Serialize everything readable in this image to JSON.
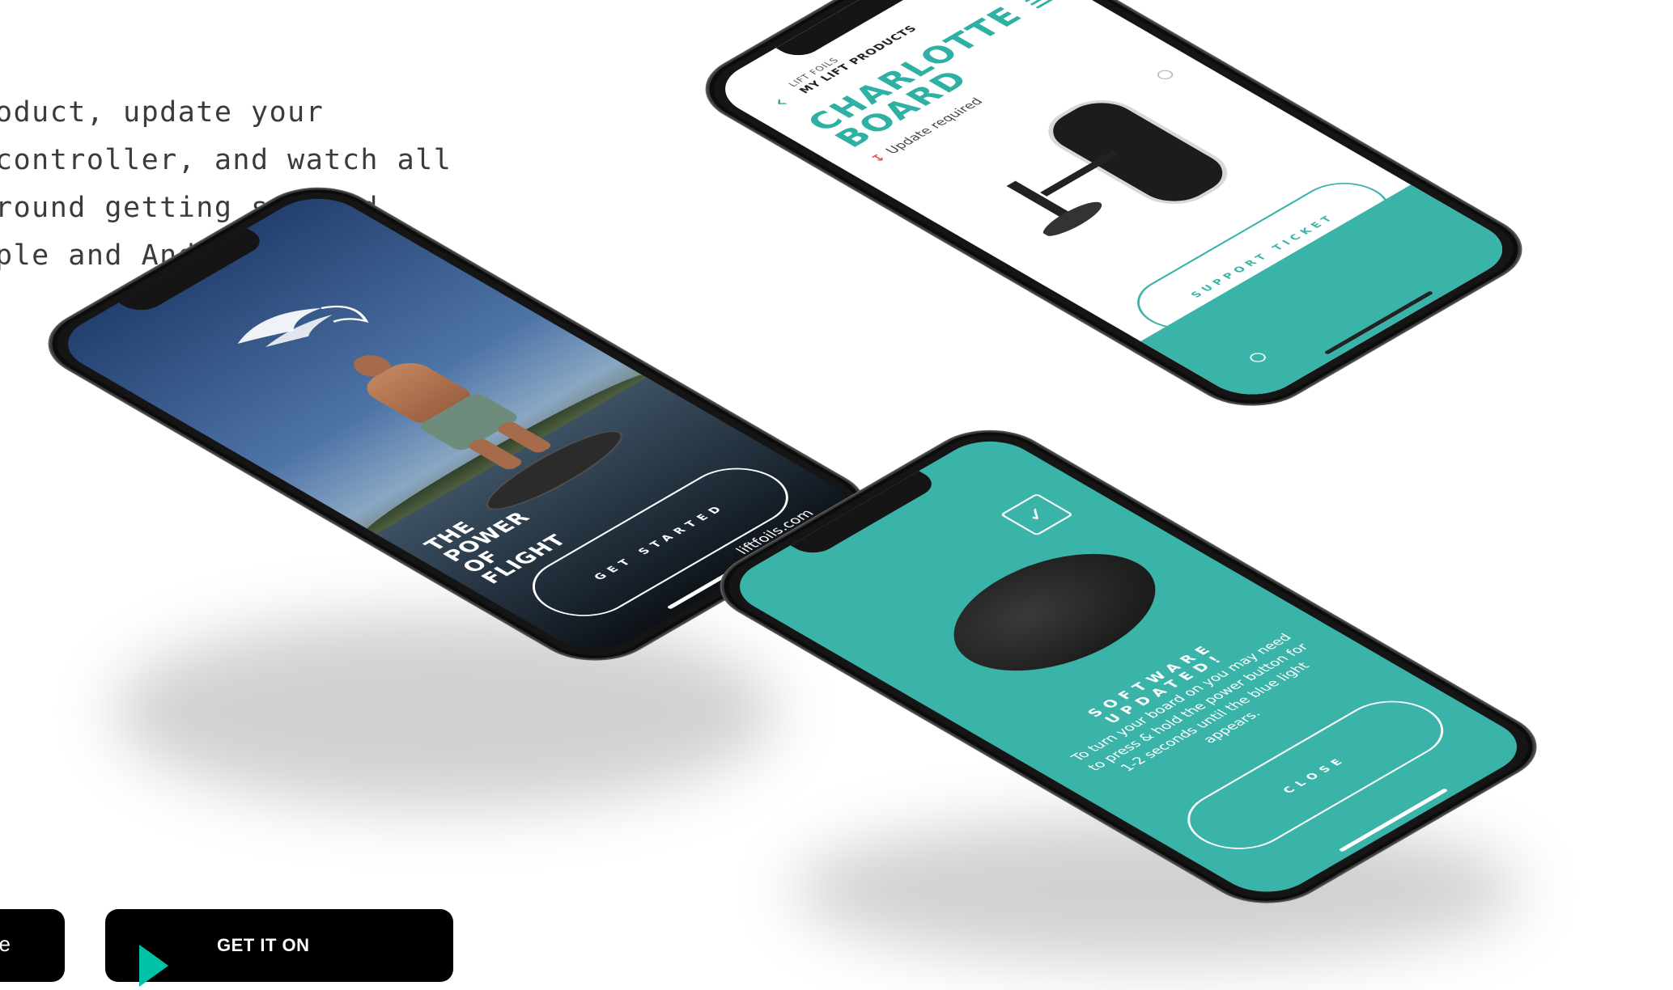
{
  "intro": {
    "lines": [
      "oduct, update your",
      " controller, and watch all",
      "round getting started",
      "ple and Android."
    ]
  },
  "phone_left": {
    "headline": [
      "THE",
      "POWER",
      "OF",
      "FLIGHT"
    ],
    "button_label": "GET STARTED",
    "site": "liftfoils.com"
  },
  "phone_top": {
    "breadcrumb_small": "LIFT FOILS",
    "breadcrumb": "MY LIFT PRODUCTS",
    "title": [
      "CHARLOTTE",
      "BOARD"
    ],
    "update_status": "Update required",
    "button_label": "SUPPORT TICKET"
  },
  "phone_bottom": {
    "heading": "SOFTWARE UPDATED!",
    "message": "To turn your board on you may need to press & hold the power button for 1-2 seconds until the blue light appears.",
    "button_label": "CLOSE"
  },
  "badges": {
    "apple_fragment": "he",
    "google_label": "GET IT ON"
  },
  "colors": {
    "accent_teal": "#3ab3a9",
    "alert_red": "#e2583f",
    "text_dark": "#3b3b3b"
  }
}
